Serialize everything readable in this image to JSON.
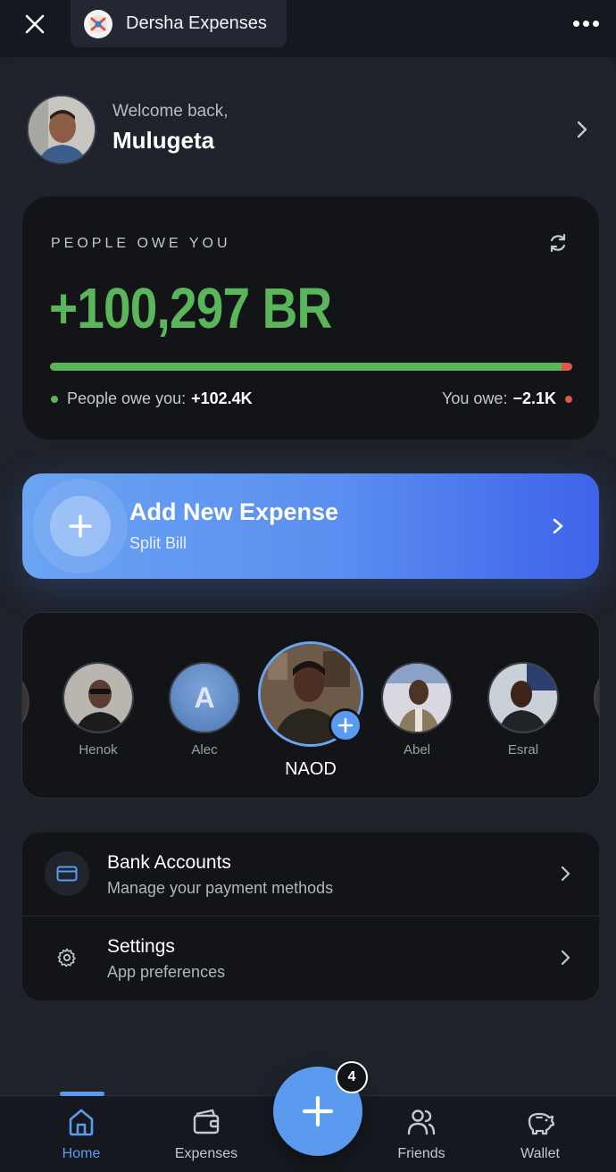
{
  "header": {
    "app_title": "Dersha Expenses"
  },
  "welcome": {
    "greeting": "Welcome back,",
    "name": "Mulugeta"
  },
  "balance": {
    "label": "PEOPLE OWE YOU",
    "amount": "+100,297 BR",
    "owed_fraction": 0.98,
    "people_owe_label": "People owe you:",
    "people_owe_value": "+102.4K",
    "you_owe_label": "You owe:",
    "you_owe_value": "−2.1K",
    "colors": {
      "positive": "#5bb55a",
      "negative": "#e0584d"
    }
  },
  "add_expense": {
    "title": "Add New Expense",
    "subtitle": "Split Bill"
  },
  "friends": [
    {
      "name": "Henok",
      "initial": ""
    },
    {
      "name": "Alec",
      "initial": "A"
    },
    {
      "name": "NAOD",
      "initial": "",
      "selected": true
    },
    {
      "name": "Abel",
      "initial": ""
    },
    {
      "name": "Esral",
      "initial": ""
    }
  ],
  "menu": [
    {
      "title": "Bank Accounts",
      "subtitle": "Manage your payment methods",
      "icon": "credit-card-icon"
    },
    {
      "title": "Settings",
      "subtitle": "App preferences",
      "icon": "gear-icon"
    }
  ],
  "bottom_nav": {
    "items": [
      {
        "label": "Home",
        "icon": "home-icon",
        "active": true
      },
      {
        "label": "Expenses",
        "icon": "wallet-icon"
      },
      {
        "label": "Friends",
        "icon": "friends-icon"
      },
      {
        "label": "Wallet",
        "icon": "piggy-bank-icon"
      }
    ],
    "fab_badge": "4"
  },
  "accent_color": "#5b9bef"
}
